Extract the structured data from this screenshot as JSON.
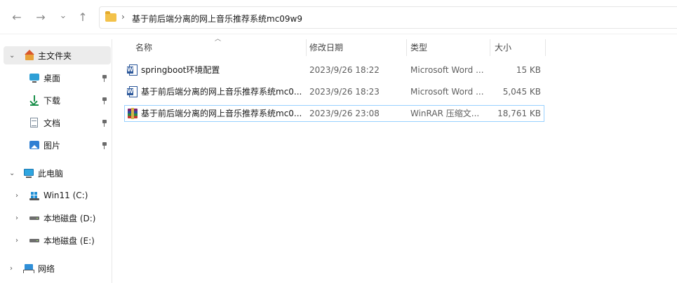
{
  "window": {
    "address_path": "基于前后端分离的网上音乐推荐系统mc09w9"
  },
  "nav": {
    "back": "←",
    "forward": "→",
    "recent": "⌄",
    "up": "↑",
    "path_separator": "›"
  },
  "sidebar": {
    "home": "主文件夹",
    "quick_access": [
      {
        "label": "桌面",
        "icon": "desktop-icon"
      },
      {
        "label": "下载",
        "icon": "download-icon"
      },
      {
        "label": "文档",
        "icon": "document-icon"
      },
      {
        "label": "图片",
        "icon": "picture-icon"
      }
    ],
    "this_pc": "此电脑",
    "drives": [
      {
        "label": "Win11 (C:)",
        "icon": "windows-drive-icon"
      },
      {
        "label": "本地磁盘 (D:)",
        "icon": "drive-icon"
      },
      {
        "label": "本地磁盘 (E:)",
        "icon": "drive-icon"
      }
    ],
    "network": "网络"
  },
  "columns": {
    "name": "名称",
    "modified": "修改日期",
    "type": "类型",
    "size": "大小"
  },
  "files": [
    {
      "name": "springboot环境配置",
      "modified": "2023/9/26 18:22",
      "type": "Microsoft Word ...",
      "size": "15 KB",
      "icon": "word-icon"
    },
    {
      "name": "基于前后端分离的网上音乐推荐系统mc0...",
      "modified": "2023/9/26 18:23",
      "type": "Microsoft Word ...",
      "size": "5,045 KB",
      "icon": "word-icon"
    },
    {
      "name": "基于前后端分离的网上音乐推荐系统mc0...",
      "modified": "2023/9/26 23:08",
      "type": "WinRAR 压缩文...",
      "size": "18,761 KB",
      "icon": "rar-icon"
    }
  ]
}
